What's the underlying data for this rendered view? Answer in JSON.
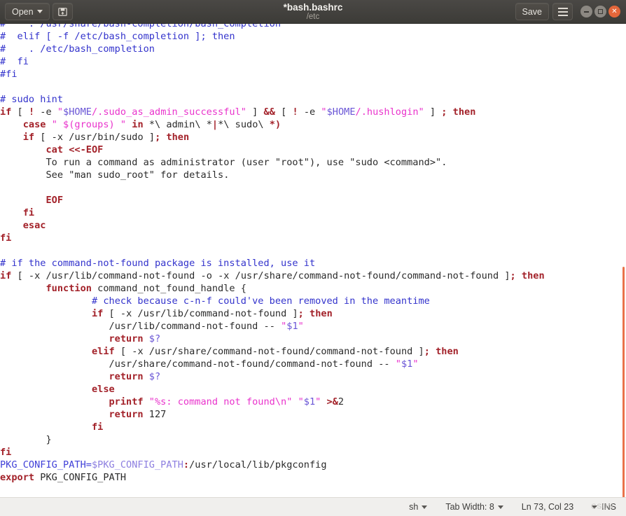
{
  "window": {
    "title": "*bash.bashrc",
    "subtitle": "/etc",
    "open_label": "Open",
    "save_label": "Save",
    "save_as_icon": "save-as-icon",
    "menu_icon": "hamburger-menu-icon",
    "minimize_icon": "minimize-icon",
    "maximize_icon": "maximize-icon",
    "close_icon": "close-icon",
    "accent_color": "#e4663a"
  },
  "statusbar": {
    "language": "sh",
    "tab_width": "Tab Width: 8",
    "cursor": "Ln 73, Col 23",
    "insert_mode": "INS",
    "watermark": "CSDN"
  },
  "editor": {
    "scrollbar_color": "#e9734a",
    "background": "#ffffff",
    "colors": {
      "comment": "#3333cc",
      "keyword": "#a3222a",
      "string": "#e933cc",
      "variable": "#6a56d6",
      "text": "#2b2b2b"
    },
    "lines": [
      "#    . /usr/share/bash-completion/bash_completion",
      "#  elif [ -f /etc/bash_completion ]; then",
      "#    . /etc/bash_completion",
      "#  fi",
      "#fi",
      "",
      "# sudo hint",
      "if [ ! -e \"$HOME/.sudo_as_admin_successful\" ] && [ ! -e \"$HOME/.hushlogin\" ] ; then",
      "    case \" $(groups) \" in *\\ admin\\ *|*\\ sudo\\ *)",
      "    if [ -x /usr/bin/sudo ]; then",
      "        cat <<-EOF",
      "        To run a command as administrator (user \"root\"), use \"sudo <command>\".",
      "        See \"man sudo_root\" for details.",
      "",
      "        EOF",
      "    fi",
      "    esac",
      "fi",
      "",
      "# if the command-not-found package is installed, use it",
      "if [ -x /usr/lib/command-not-found -o -x /usr/share/command-not-found/command-not-found ]; then",
      "        function command_not_found_handle {",
      "                # check because c-n-f could've been removed in the meantime",
      "                if [ -x /usr/lib/command-not-found ]; then",
      "                   /usr/lib/command-not-found -- \"$1\"",
      "                   return $?",
      "                elif [ -x /usr/share/command-not-found/command-not-found ]; then",
      "                   /usr/share/command-not-found/command-not-found -- \"$1\"",
      "                   return $?",
      "                else",
      "                   printf \"%s: command not found\\n\" \"$1\" >&2",
      "                   return 127",
      "                fi",
      "        }",
      "fi",
      "PKG_CONFIG_PATH=$PKG_CONFIG_PATH:/usr/local/lib/pkgconfig",
      "export PKG_CONFIG_PATH"
    ]
  }
}
